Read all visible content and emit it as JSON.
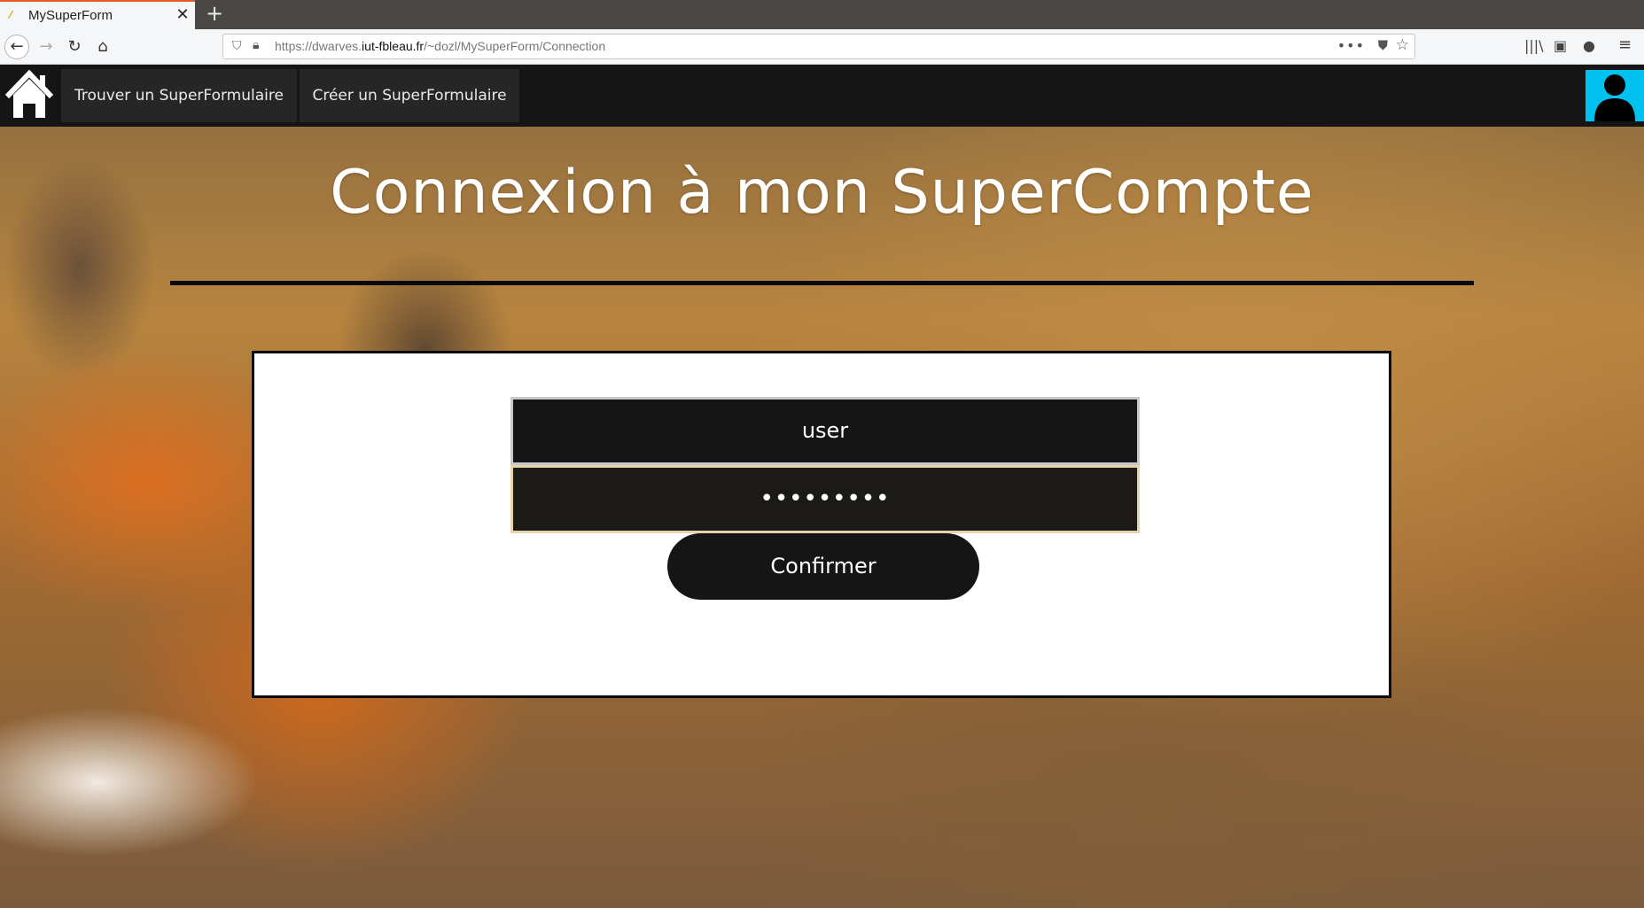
{
  "browser": {
    "tab_title": "MySuperForm",
    "tab_close": "✕",
    "new_tab": "+",
    "url_prefix": "https://dwarves.",
    "url_domain": "iut-fbleau.fr",
    "url_path": "/~dozl/MySuperForm/Connection",
    "url_more": "•••",
    "nav_back": "←",
    "nav_forward": "→",
    "nav_reload": "↻",
    "nav_home": "⌂"
  },
  "site_nav": {
    "find_label": "Trouver un SuperFormulaire",
    "create_label": "Créer un SuperFormulaire",
    "profile_color": "#00c2f0"
  },
  "main": {
    "title": "Connexion à mon SuperCompte",
    "username_value": "user",
    "password_value": "•••••••••",
    "confirm_label": "Confirmer"
  },
  "icons": {
    "home": "home-icon",
    "profile": "user-icon"
  }
}
